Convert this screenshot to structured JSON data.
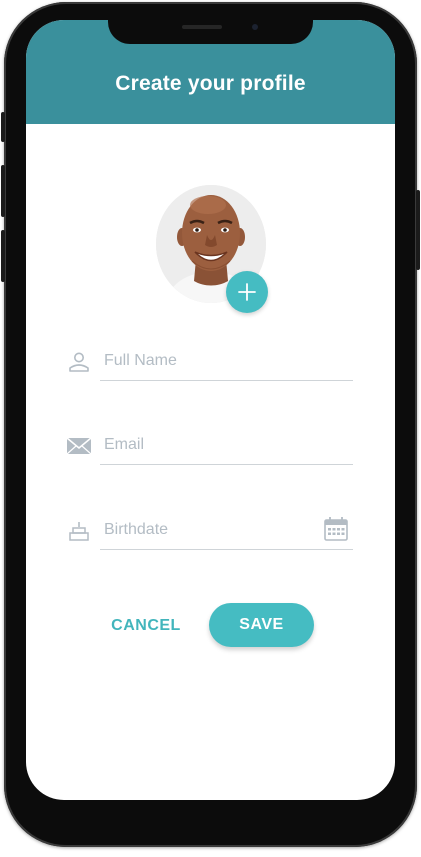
{
  "header": {
    "title": "Create your profile"
  },
  "avatar": {
    "add_icon": "plus-icon"
  },
  "form": {
    "full_name": {
      "placeholder": "Full Name",
      "value": "",
      "icon": "person-icon"
    },
    "email": {
      "placeholder": "Email",
      "value": "",
      "icon": "envelope-icon"
    },
    "birthdate": {
      "placeholder": "Birthdate",
      "value": "",
      "icon": "cake-icon",
      "picker_icon": "calendar-icon"
    }
  },
  "actions": {
    "cancel_label": "CANCEL",
    "save_label": "SAVE"
  },
  "colors": {
    "header_bg": "#3a909c",
    "accent": "#45bcc2",
    "icon_gray": "#b3bcc4"
  }
}
